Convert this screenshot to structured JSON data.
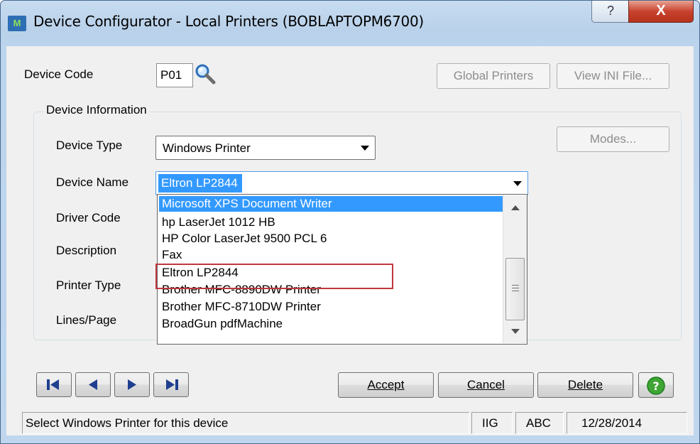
{
  "window": {
    "title": "Device Configurator - Local Printers (BOBLAPTOPM6700)",
    "icon": "app-icon",
    "help_label": "?",
    "close_label": "X"
  },
  "device_code": {
    "label": "Device Code",
    "value": "P01"
  },
  "buttons": {
    "global_printers": "Global Printers",
    "view_ini": "View INI File...",
    "modes": "Modes...",
    "accept": "Accept",
    "cancel": "Cancel",
    "delete": "Delete"
  },
  "group": {
    "title": "Device Information"
  },
  "fields": {
    "device_type_label": "Device Type",
    "device_type_value": "Windows Printer",
    "device_name_label": "Device Name",
    "device_name_value": "Eltron LP2844",
    "driver_code_label": "Driver Code",
    "description_label": "Description",
    "printer_type_label": "Printer Type",
    "lines_page_label": "Lines/Page"
  },
  "dropdown": {
    "items": [
      "Microsoft XPS Document Writer",
      "hp LaserJet 1012 HB",
      "HP Color LaserJet 9500 PCL 6",
      "Fax",
      "Eltron LP2844",
      "Brother MFC-8890DW Printer",
      "Brother MFC-8710DW Printer",
      "BroadGun pdfMachine"
    ],
    "highlighted_index": 0,
    "outlined_item": "Eltron LP2844"
  },
  "nav": [
    "first-record",
    "previous-record",
    "next-record",
    "last-record"
  ],
  "status_bar": {
    "message": "Select Windows Printer for this device",
    "company": "IIG",
    "user": "ABC",
    "date": "12/28/2014"
  },
  "colors": {
    "selection": "#3399ff",
    "highlight_outline": "#c0373d",
    "help_icon": "#3fa535"
  }
}
